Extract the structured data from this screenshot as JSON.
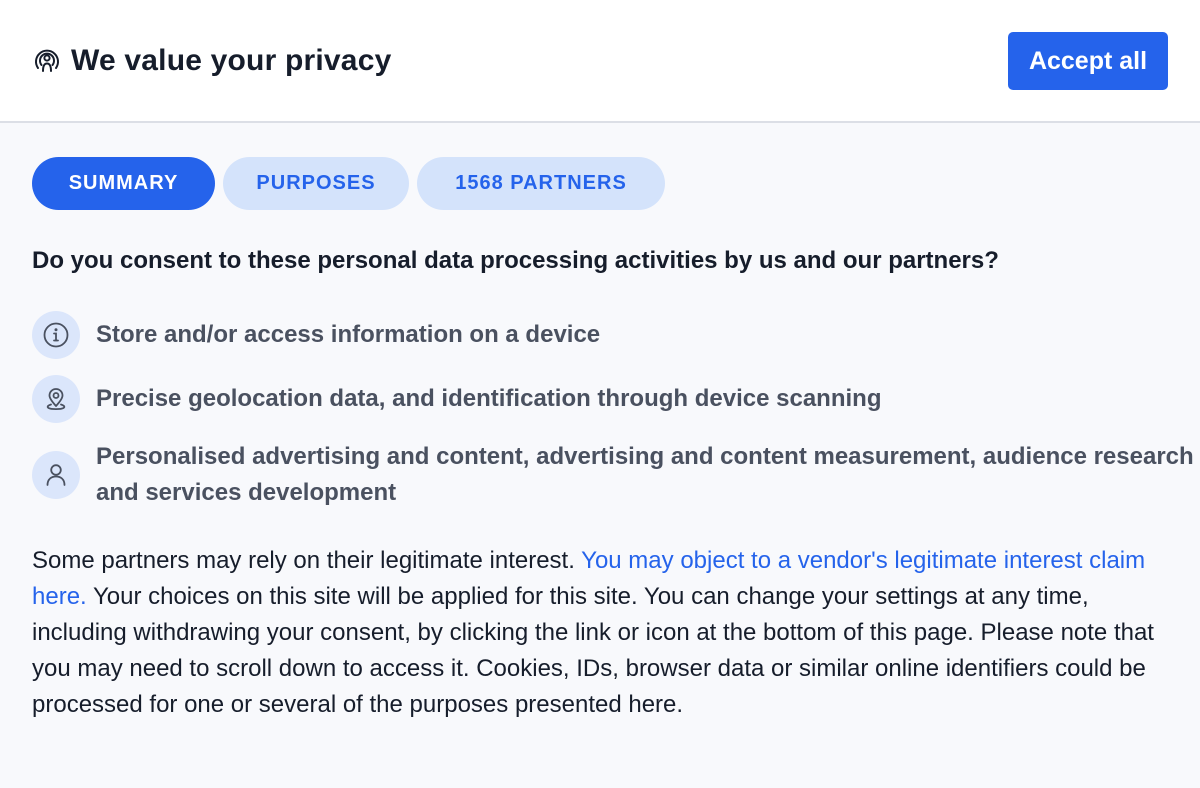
{
  "header": {
    "title": "We value your privacy",
    "title_icon": "privacy-icon",
    "accept_label": "Accept all"
  },
  "tabs": [
    {
      "label": "SUMMARY",
      "active": true
    },
    {
      "label": "PURPOSES",
      "active": false
    },
    {
      "label": "1568 PARTNERS",
      "active": false
    }
  ],
  "question": "Do you consent to these personal data processing activities by us and our partners?",
  "purposes": [
    {
      "icon": "info-icon",
      "text": "Store and/or access information on a device"
    },
    {
      "icon": "location-pin-icon",
      "text": "Precise geolocation data, and identification through device scanning"
    },
    {
      "icon": "person-icon",
      "text": "Personalised advertising and content, advertising and content measurement, audience research and services development"
    }
  ],
  "description": {
    "part1": "Some partners may rely on their legitimate interest. ",
    "link": "You may object to a vendor's legitimate interest claim here.",
    "part2": " Your choices on this site will be applied for this site. You can change your settings at any time, including withdrawing your consent, by clicking the link or icon at the bottom of this page. Please note that you may need to scroll down to access it. Cookies, IDs, browser data or similar online identifiers could be processed for one or several of the purposes presented here."
  },
  "colors": {
    "accent": "#2563eb",
    "tab_inactive_bg": "#d4e3fb",
    "icon_bg": "#dbe6fb",
    "text": "#161d2b",
    "muted_text": "#4a5160"
  }
}
